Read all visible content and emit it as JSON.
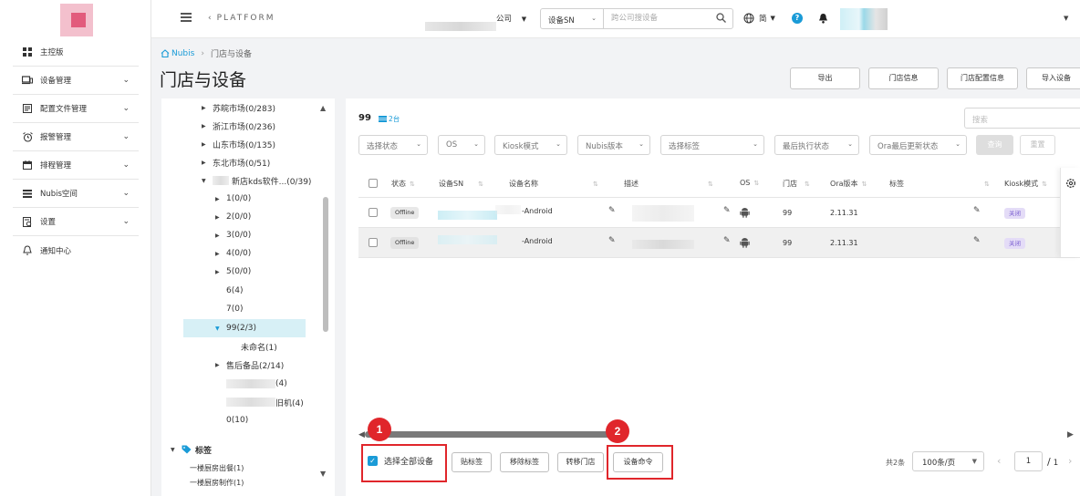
{
  "sidebar": {
    "items": [
      {
        "label": "主控版",
        "icon": "dashboard-icon",
        "has_chevron": false
      },
      {
        "label": "设备管理",
        "icon": "device-icon",
        "has_chevron": true
      },
      {
        "label": "配置文件管理",
        "icon": "config-file-icon",
        "has_chevron": true
      },
      {
        "label": "报警管理",
        "icon": "alarm-clock-icon",
        "has_chevron": true
      },
      {
        "label": "排程管理",
        "icon": "calendar-icon",
        "has_chevron": true
      },
      {
        "label": "Nubis空间",
        "icon": "list-icon",
        "has_chevron": true
      },
      {
        "label": "设置",
        "icon": "settings-doc-icon",
        "has_chevron": true
      },
      {
        "label": "通知中心",
        "icon": "bell-icon",
        "has_chevron": false
      }
    ]
  },
  "topbar": {
    "back": "‹",
    "platform": "PLATFORM",
    "company_label": "公司",
    "search_type": "设备SN",
    "search_placeholder": "跨公司搜设备",
    "lang": "简"
  },
  "breadcrumb": {
    "home": "Nubis",
    "current": "门店与设备"
  },
  "page_title": "门店与设备",
  "top_actions": {
    "export": "导出",
    "store_info": "门店信息",
    "store_config": "门店配置信息",
    "import_device": "导入设备"
  },
  "tree": {
    "regions": [
      "苏皖市场(0/283)",
      "浙江市场(0/236)",
      "山东市场(0/135)",
      "东北市场(0/51)"
    ],
    "store_group": "新店kds软件...(0/39)",
    "sub_nodes": [
      "1(0/0)",
      "2(0/0)",
      "3(0/0)",
      "4(0/0)",
      "5(0/0)"
    ],
    "leaf_nodes": [
      "6(4)",
      "7(0)"
    ],
    "selected": "99(2/3)",
    "selected_child": "未命名(1)",
    "after_sales": "售后备品(2/14)",
    "blur_node1_suffix": "(4)",
    "blur_node2_suffix": "旧机(4)",
    "zero_node": "0(10)",
    "tags_label": "标签",
    "tag_items": [
      "一楼厨房出餐(1)",
      "一楼厨房制作(1)"
    ]
  },
  "main": {
    "store_name": "99",
    "device_count": "2台",
    "search_placeholder": "搜索",
    "filters": [
      "选择状态",
      "OS",
      "Kiosk模式",
      "Nubis版本",
      "选择标签",
      "最后执行状态",
      "Ora最后更新状态"
    ],
    "query": "查询",
    "reset": "重置"
  },
  "table": {
    "columns": [
      "状态",
      "设备SN",
      "设备名称",
      "描述",
      "OS",
      "门店",
      "Ora版本",
      "标签",
      "Kiosk模式"
    ],
    "rows": [
      {
        "status": "Offline",
        "name_suffix": "-Android",
        "store": "99",
        "ora_version": "2.11.31",
        "kiosk": "关闭"
      },
      {
        "status": "Offline",
        "name_suffix": "-Android",
        "store": "99",
        "ora_version": "2.11.31",
        "kiosk": "关闭"
      }
    ]
  },
  "footer": {
    "badge1": "1",
    "badge2": "2",
    "select_all": "选择全部设备",
    "paste_tag": "贴标签",
    "remove_tag": "移除标签",
    "transfer_store": "转移门店",
    "device_command": "设备命令",
    "total": "共2条",
    "per_page": "100条/页",
    "current_page": "1",
    "page_sep": "/",
    "total_pages": "1"
  },
  "colors": {
    "accent": "#1a9bd7",
    "highlight_red": "#e0262b",
    "selected_tree_bg": "#d7f0f6",
    "kiosk_badge": "#e4dcf7"
  }
}
